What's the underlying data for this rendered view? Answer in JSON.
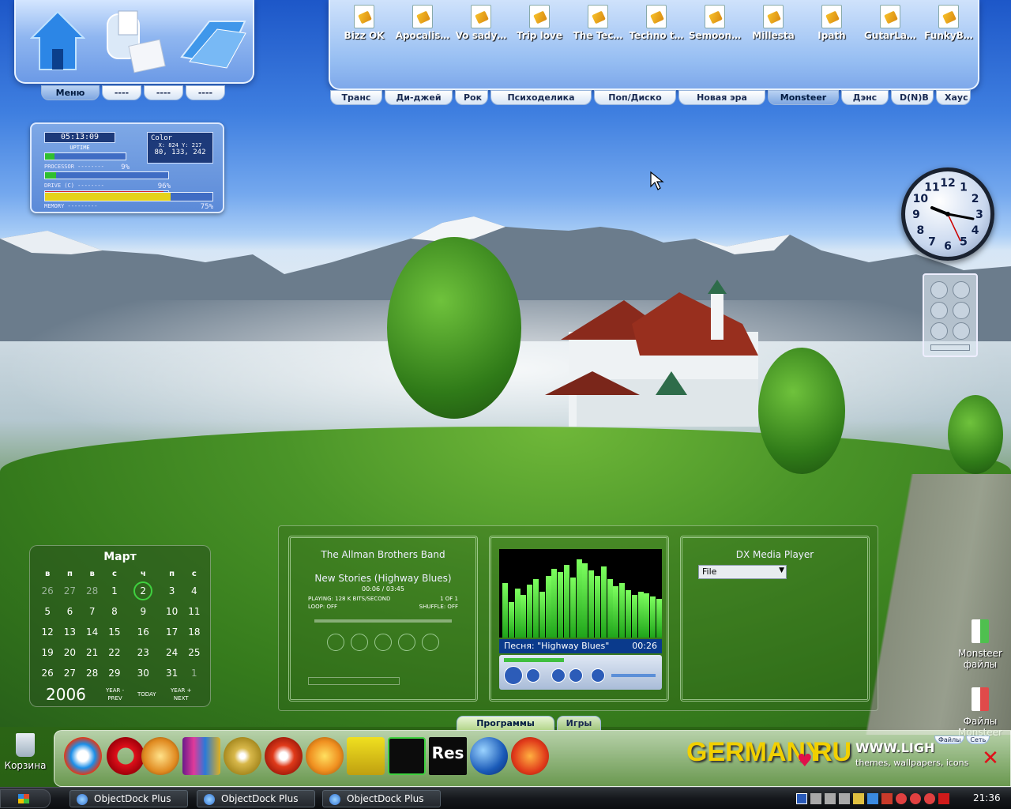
{
  "menu_panel": {
    "tabs": [
      "Меню",
      "----",
      "----",
      "----"
    ]
  },
  "music_panel": {
    "files": [
      "Bizz OK",
      "Apocalis…",
      "Vo sady…",
      "Trip love",
      "The Tec…",
      "Techno t…",
      "Semoon…",
      "Millesta",
      "Ipath",
      "GutarLa…",
      "FunkyB…"
    ],
    "tabs": [
      "Транс",
      "Ди-джей",
      "Рок",
      "Психоделика",
      "Поп/Диско",
      "Новая эра",
      "Monsteer",
      "Дэнс",
      "D(N)B",
      "Хаус"
    ],
    "active_tab": "Monsteer"
  },
  "monitor": {
    "uptime": "05:13:09",
    "uptime_label": "UPTIME",
    "color_label": "Color",
    "coords": "X: 824  Y: 217",
    "rgb": "80, 133, 242",
    "processor_label": "PROCESSOR --------",
    "processor_value": "9%",
    "processor_pct": 9,
    "drive_label": "DRIVE (C) --------",
    "drive_value": "96%",
    "drive_pct": 96,
    "memory_label": "MEMORY ---------",
    "memory_value": "75%",
    "memory_pct": 75
  },
  "clock": {
    "numbers": [
      "12",
      "1",
      "2",
      "3",
      "4",
      "5",
      "6",
      "7",
      "8",
      "9",
      "10",
      "11"
    ]
  },
  "calendar": {
    "month": "Март",
    "year": "2006",
    "weekdays": [
      "в",
      "п",
      "в",
      "с",
      "ч",
      "п",
      "с"
    ],
    "rows": [
      [
        "26",
        "27",
        "28",
        "1",
        "2",
        "3",
        "4"
      ],
      [
        "5",
        "6",
        "7",
        "8",
        "9",
        "10",
        "11"
      ],
      [
        "12",
        "13",
        "14",
        "15",
        "16",
        "17",
        "18"
      ],
      [
        "19",
        "20",
        "21",
        "22",
        "23",
        "24",
        "25"
      ],
      [
        "26",
        "27",
        "28",
        "29",
        "30",
        "31",
        "1"
      ]
    ],
    "today": "2",
    "nav": {
      "prev": "YEAR -\nPREV",
      "today": "TODAY",
      "next": "YEAR +\nNEXT"
    }
  },
  "player1": {
    "artist": "The Allman Brothers Band",
    "title": "New Stories (Highway Blues)",
    "time": "00:06 / 03:45",
    "playing": "PLAYING: 128 K BITS/SECOND",
    "count": "1 OF 1",
    "loop": "LOOP: OFF",
    "shuffle": "SHUFFLE: OFF"
  },
  "player2": {
    "song": "Песня: \"Highway Blues\"",
    "time": "00:26",
    "levels": [
      62,
      40,
      55,
      48,
      60,
      66,
      52,
      70,
      78,
      74,
      82,
      68,
      88,
      84,
      76,
      70,
      80,
      66,
      58,
      62,
      54,
      48,
      52,
      50,
      46,
      44
    ]
  },
  "player3": {
    "title": "DX Media Player",
    "select_value": "File"
  },
  "desktop_icons": {
    "monsteer_files": "Monsteer файлы",
    "files_monsteer": "Файлы Monsteer",
    "recycle_bin": "Корзина"
  },
  "dock": {
    "tabs": [
      "Программы",
      "Игры"
    ],
    "active_tab": "Программы",
    "banner_left": "GERMANY",
    "banner_right": "RU",
    "banner_url": "WWW.LIGH",
    "banner_sub": "themes, wallpapers, icons",
    "mini_tabs": [
      "Файлы",
      "Сеть"
    ]
  },
  "taskbar": {
    "buttons": [
      "ObjectDock Plus",
      "ObjectDock Plus",
      "ObjectDock Plus"
    ],
    "clock": "21:36"
  },
  "colors": {
    "accent": "#3f6cc4",
    "drive_bar": "#d8202a",
    "memory_bar": "#e5d21a",
    "processor_bar": "#2fbf2f"
  }
}
